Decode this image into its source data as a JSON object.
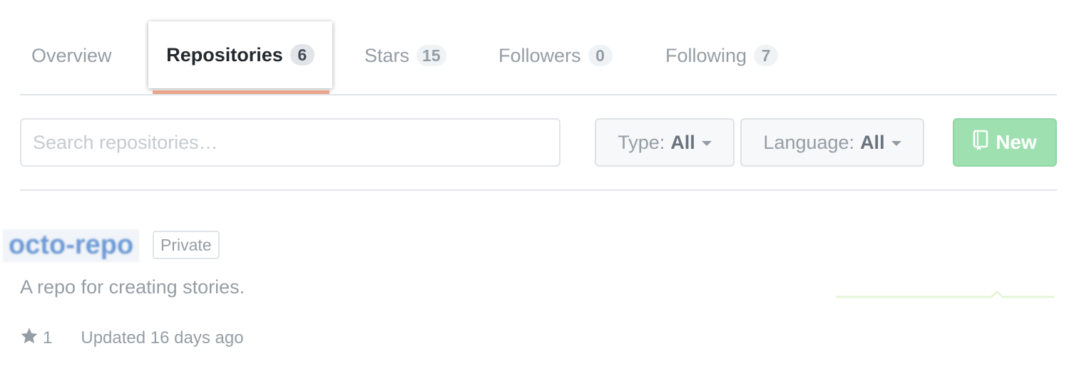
{
  "nav": {
    "tabs": [
      {
        "label": "Overview"
      },
      {
        "label": "Repositories",
        "count": "6"
      },
      {
        "label": "Stars",
        "count": "15"
      },
      {
        "label": "Followers",
        "count": "0"
      },
      {
        "label": "Following",
        "count": "7"
      }
    ],
    "active_tab": "Repositories"
  },
  "filters": {
    "search_placeholder": "Search repositories…",
    "type_label": "Type:",
    "type_value": "All",
    "language_label": "Language:",
    "language_value": "All",
    "new_label": "New"
  },
  "repo": {
    "name": "octo-repo",
    "visibility": "Private",
    "description": "A repo for creating stories.",
    "stars": "1",
    "updated": "Updated 16 days ago"
  },
  "colors": {
    "active_underline": "#e9a48a",
    "new_button": "#9fe0b1",
    "repo_link": "#6d9ad6",
    "muted_text": "#959da5"
  },
  "icons": {
    "new_button": "repo-book-icon",
    "stars": "star-icon",
    "dropdown": "caret-down-icon"
  }
}
